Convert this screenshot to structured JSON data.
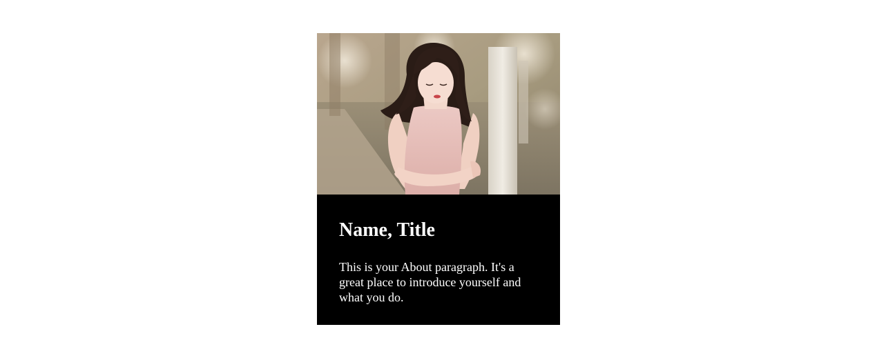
{
  "profile_card": {
    "photo_description": "portrait-photo",
    "name_title": "Name, Title",
    "about_paragraph": "This is your About paragraph. It's a great place to introduce yourself and what you do.",
    "colors": {
      "panel_background": "#000000",
      "text": "#ffffff"
    }
  }
}
